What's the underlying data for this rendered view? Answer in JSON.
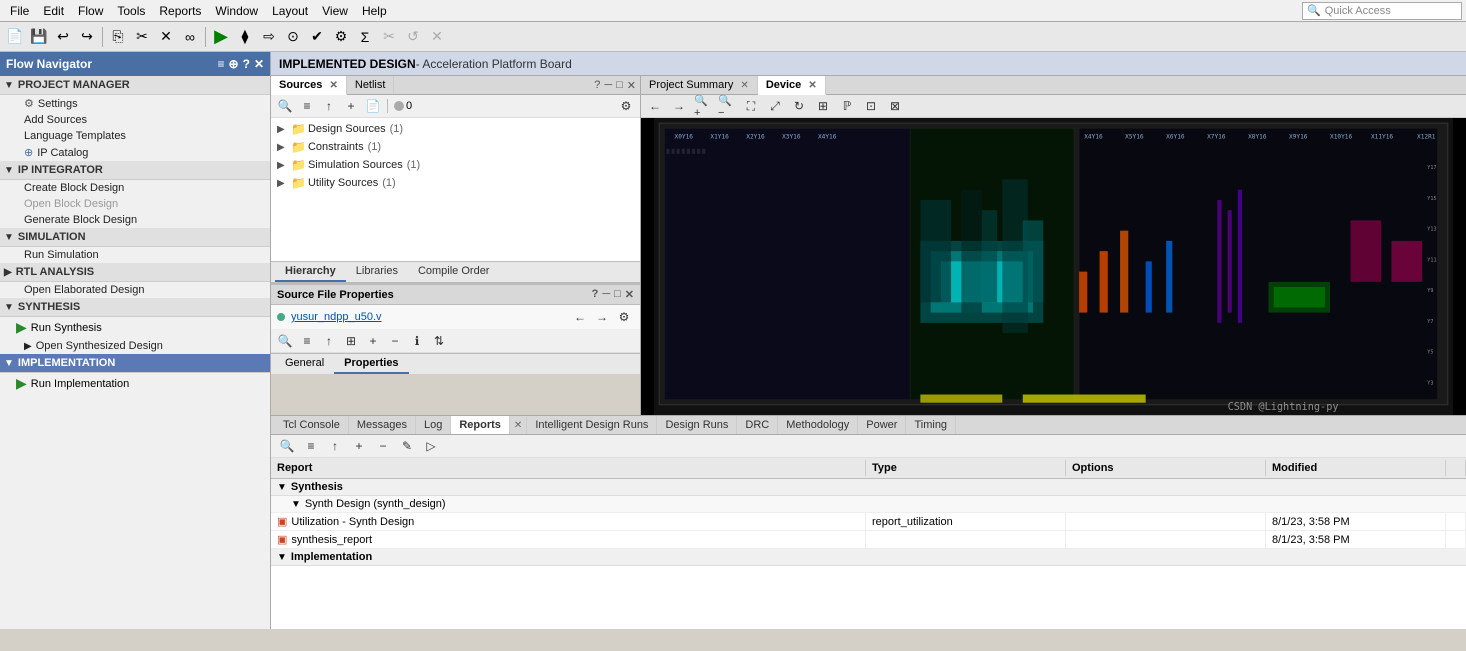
{
  "menubar": {
    "items": [
      "File",
      "Edit",
      "Flow",
      "Tools",
      "Reports",
      "Window",
      "Layout",
      "View",
      "Help"
    ]
  },
  "quickaccess": {
    "label": "Quick Access",
    "placeholder": "Quick Access"
  },
  "design_title": {
    "bold": "IMPLEMENTED DESIGN",
    "normal": " - Acceleration Platform Board"
  },
  "flow_navigator": {
    "title": "Flow Navigator",
    "sections": [
      {
        "name": "PROJECT MANAGER",
        "items": [
          "Settings",
          "Add Sources",
          "Language Templates",
          "IP Catalog"
        ]
      },
      {
        "name": "IP INTEGRATOR",
        "items": [
          "Create Block Design",
          "Open Block Design",
          "Generate Block Design"
        ]
      },
      {
        "name": "SIMULATION",
        "items": [
          "Run Simulation"
        ]
      },
      {
        "name": "RTL ANALYSIS",
        "items": [
          "Open Elaborated Design"
        ]
      },
      {
        "name": "SYNTHESIS",
        "items": [
          "Run Synthesis",
          "Open Synthesized Design"
        ]
      },
      {
        "name": "IMPLEMENTATION",
        "items": [
          "Run Implementation"
        ]
      }
    ]
  },
  "sources_panel": {
    "tabs": [
      "Sources",
      "Netlist"
    ],
    "active_tab": "Sources",
    "tree": [
      {
        "label": "Design Sources",
        "count": "(1)",
        "indent": 0
      },
      {
        "label": "Constraints",
        "count": "(1)",
        "indent": 0
      },
      {
        "label": "Simulation Sources",
        "count": "(1)",
        "indent": 0
      },
      {
        "label": "Utility Sources",
        "count": "(1)",
        "indent": 0
      }
    ],
    "bottom_tabs": [
      "Hierarchy",
      "Libraries",
      "Compile Order"
    ]
  },
  "sfp": {
    "title": "Source File Properties",
    "filename": "yusur_ndpp_u50.v",
    "tabs": [
      "General",
      "Properties"
    ],
    "active_tab": "Properties"
  },
  "device_panel": {
    "tabs": [
      "Project Summary",
      "Device"
    ],
    "active_tab": "Device"
  },
  "device_toolbar": {
    "buttons": [
      "←",
      "→",
      "🔍+",
      "🔍-",
      "⛶",
      "⤢",
      "↻",
      "⊞",
      "ℙ",
      "⊡",
      "⊞₂"
    ]
  },
  "bottom_panel": {
    "tabs": [
      "Tcl Console",
      "Messages",
      "Log",
      "Reports",
      "Intelligent Design Runs",
      "Design Runs",
      "DRC",
      "Methodology",
      "Power",
      "Timing"
    ],
    "active_tab": "Reports",
    "toolbar_buttons": [
      "🔍",
      "≡",
      "↑",
      "+",
      "−",
      "✎",
      "▷"
    ]
  },
  "reports_table": {
    "headers": [
      "Report",
      "Type",
      "Options",
      "Modified",
      ""
    ],
    "sections": [
      {
        "name": "Synthesis",
        "subsections": [
          {
            "name": "Synth Design (synth_design)",
            "rows": [
              {
                "report": "Utilization - Synth Design",
                "type": "report_utilization",
                "options": "",
                "modified": "8/1/23, 3:58 PM"
              },
              {
                "report": "synthesis_report",
                "type": "",
                "options": "",
                "modified": "8/1/23, 3:58 PM"
              }
            ]
          }
        ]
      },
      {
        "name": "Implementation",
        "subsections": []
      }
    ]
  },
  "watermark": "CSDN @Lightning-py",
  "icons": {
    "search": "🔍",
    "filter": "≡",
    "collapse": "⊟",
    "add": "+",
    "file": "📄",
    "circle": "●",
    "settings": "⚙",
    "close": "✕",
    "minimize": "─",
    "maximize": "□",
    "back": "←",
    "forward": "→",
    "run": "▶",
    "help": "?",
    "expand_more": "▼",
    "expand_less": "▶",
    "chevron_right": "›"
  }
}
